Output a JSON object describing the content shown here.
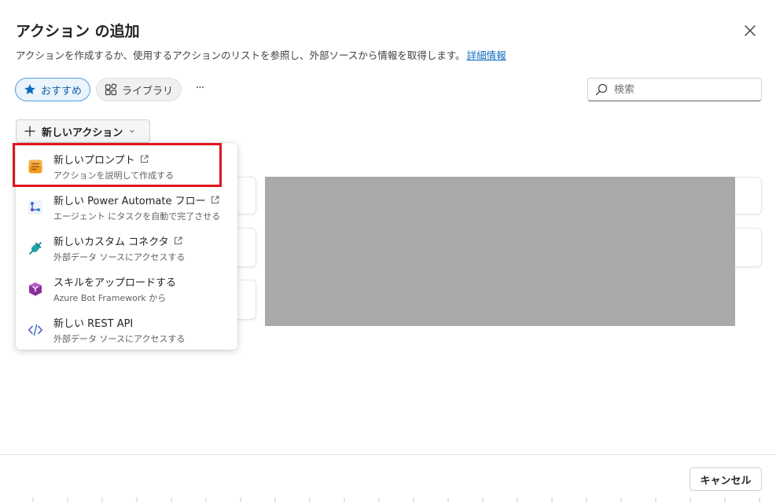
{
  "dialog": {
    "title": "アクション の追加",
    "subtitle": "アクションを作成するか、使用するアクションのリストを参照し、外部ソースから情報を取得します。",
    "learn_more": "詳細情報"
  },
  "filters": {
    "recommended": "おすすめ",
    "library": "ライブラリ",
    "more": "···"
  },
  "search": {
    "placeholder": "検索"
  },
  "new_action_button": "新しいアクション",
  "menu": {
    "items": [
      {
        "title": "新しいプロンプト",
        "description": "アクションを説明して作成する",
        "icon": "prompt-icon",
        "external": true
      },
      {
        "title": "新しい Power Automate フロー",
        "description": "エージェント にタスクを自動で完了させる",
        "icon": "power-automate-icon",
        "external": true
      },
      {
        "title": "新しいカスタム コネクタ",
        "description": "外部データ ソースにアクセスする",
        "icon": "plug-icon",
        "external": true
      },
      {
        "title": "スキルをアップロードする",
        "description": "Azure Bot Framework から",
        "icon": "cube-icon",
        "external": false
      },
      {
        "title": "新しい REST API",
        "description": "外部データ ソースにアクセスする",
        "icon": "code-icon",
        "external": false
      }
    ]
  },
  "footer": {
    "cancel": "キャンセル"
  },
  "colors": {
    "accent": "#0f6cbd",
    "highlight": "#e0161b",
    "masked": "#a9a9a9"
  }
}
